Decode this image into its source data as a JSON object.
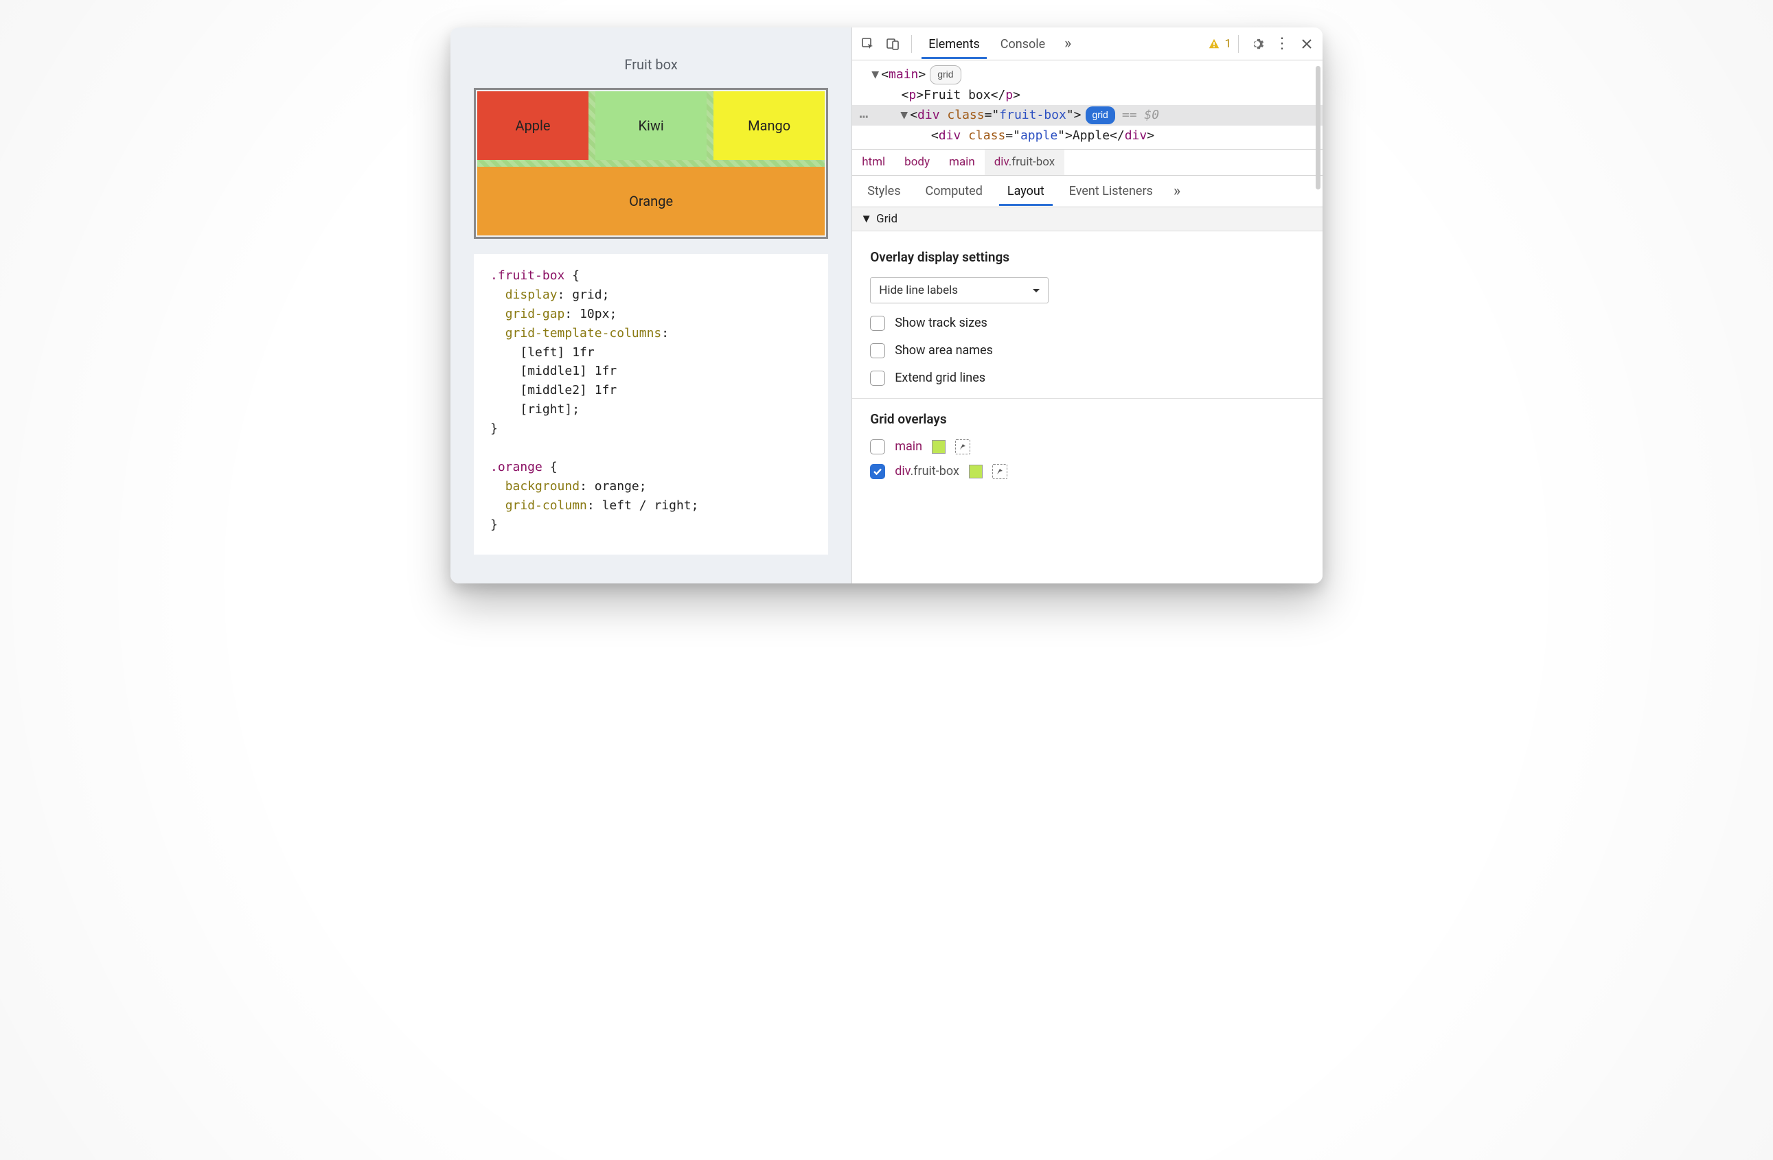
{
  "page": {
    "title": "Fruit box",
    "cells": {
      "apple": "Apple",
      "kiwi": "Kiwi",
      "mango": "Mango",
      "orange": "Orange"
    },
    "css": {
      "sel1": ".fruit-box",
      "rules1": [
        {
          "p": "display",
          "v": "grid"
        },
        {
          "p": "grid-gap",
          "v": "10px"
        },
        {
          "p": "grid-template-columns",
          "v": ""
        }
      ],
      "lines1": [
        "[left] 1fr",
        "[middle1] 1fr",
        "[middle2] 1fr",
        "[right];"
      ],
      "sel2": ".orange",
      "rules2": [
        {
          "p": "background",
          "v": "orange"
        },
        {
          "p": "grid-column",
          "v": "left / right"
        }
      ]
    }
  },
  "devtools": {
    "tabs": {
      "elements": "Elements",
      "console": "Console"
    },
    "warning_count": "1",
    "dom": {
      "main_open": "main",
      "main_badge": "grid",
      "p_text": "Fruit box",
      "div_class": "fruit-box",
      "div_badge": "grid",
      "eq": "== $0",
      "child_class": "apple",
      "child_text": "Apple"
    },
    "breadcrumb": [
      "html",
      "body",
      "main",
      "div.fruit-box"
    ],
    "subtabs": {
      "styles": "Styles",
      "computed": "Computed",
      "layout": "Layout",
      "listeners": "Event Listeners"
    },
    "layout": {
      "section": "Grid",
      "overlay_heading": "Overlay display settings",
      "select_value": "Hide line labels",
      "show_track_sizes": "Show track sizes",
      "show_area_names": "Show area names",
      "extend_grid_lines": "Extend grid lines",
      "grid_overlays_heading": "Grid overlays",
      "overlays": [
        {
          "name": "main",
          "checked": false
        },
        {
          "name": "div.fruit-box",
          "checked": true
        }
      ]
    }
  }
}
